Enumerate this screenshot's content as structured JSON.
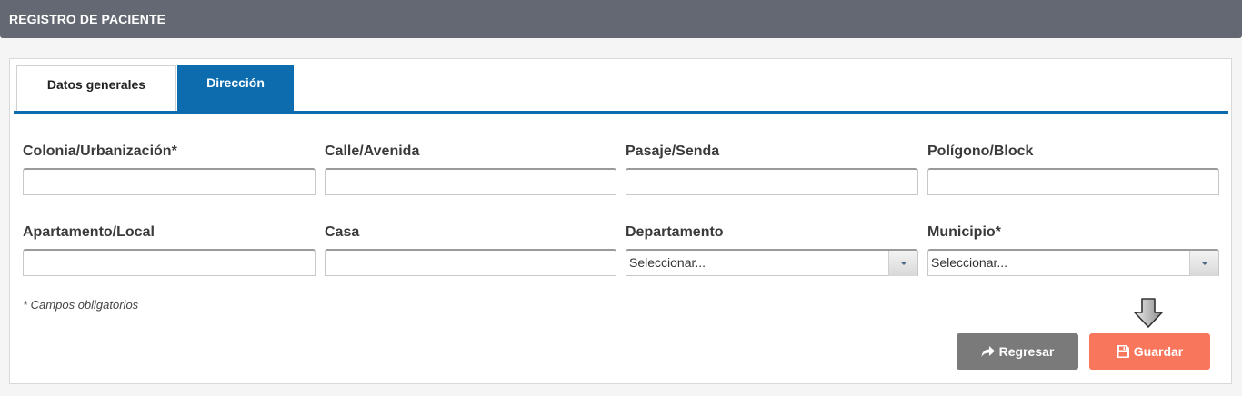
{
  "header": {
    "title": "REGISTRO DE PACIENTE"
  },
  "tabs": [
    {
      "label": "Datos generales",
      "active": false
    },
    {
      "label": "Dirección",
      "active": true
    }
  ],
  "fields": {
    "colonia": {
      "label": "Colonia/Urbanización*",
      "value": ""
    },
    "calle": {
      "label": "Calle/Avenida",
      "value": ""
    },
    "pasaje": {
      "label": "Pasaje/Senda",
      "value": ""
    },
    "poligono": {
      "label": "Polígono/Block",
      "value": ""
    },
    "apartamento": {
      "label": "Apartamento/Local",
      "value": ""
    },
    "casa": {
      "label": "Casa",
      "value": ""
    },
    "departamento": {
      "label": "Departamento",
      "selected": "Seleccionar..."
    },
    "municipio": {
      "label": "Municipio*",
      "selected": "Seleccionar..."
    }
  },
  "note": "* Campos obligatorios",
  "buttons": {
    "back_label": "Regresar",
    "back_icon": "share-arrow-icon",
    "save_label": "Guardar",
    "save_icon": "floppy-disk-icon"
  },
  "colors": {
    "header_bg": "#646872",
    "accent": "#0c6cae",
    "save_button": "#f8775c",
    "back_button": "#7a7a7a"
  }
}
